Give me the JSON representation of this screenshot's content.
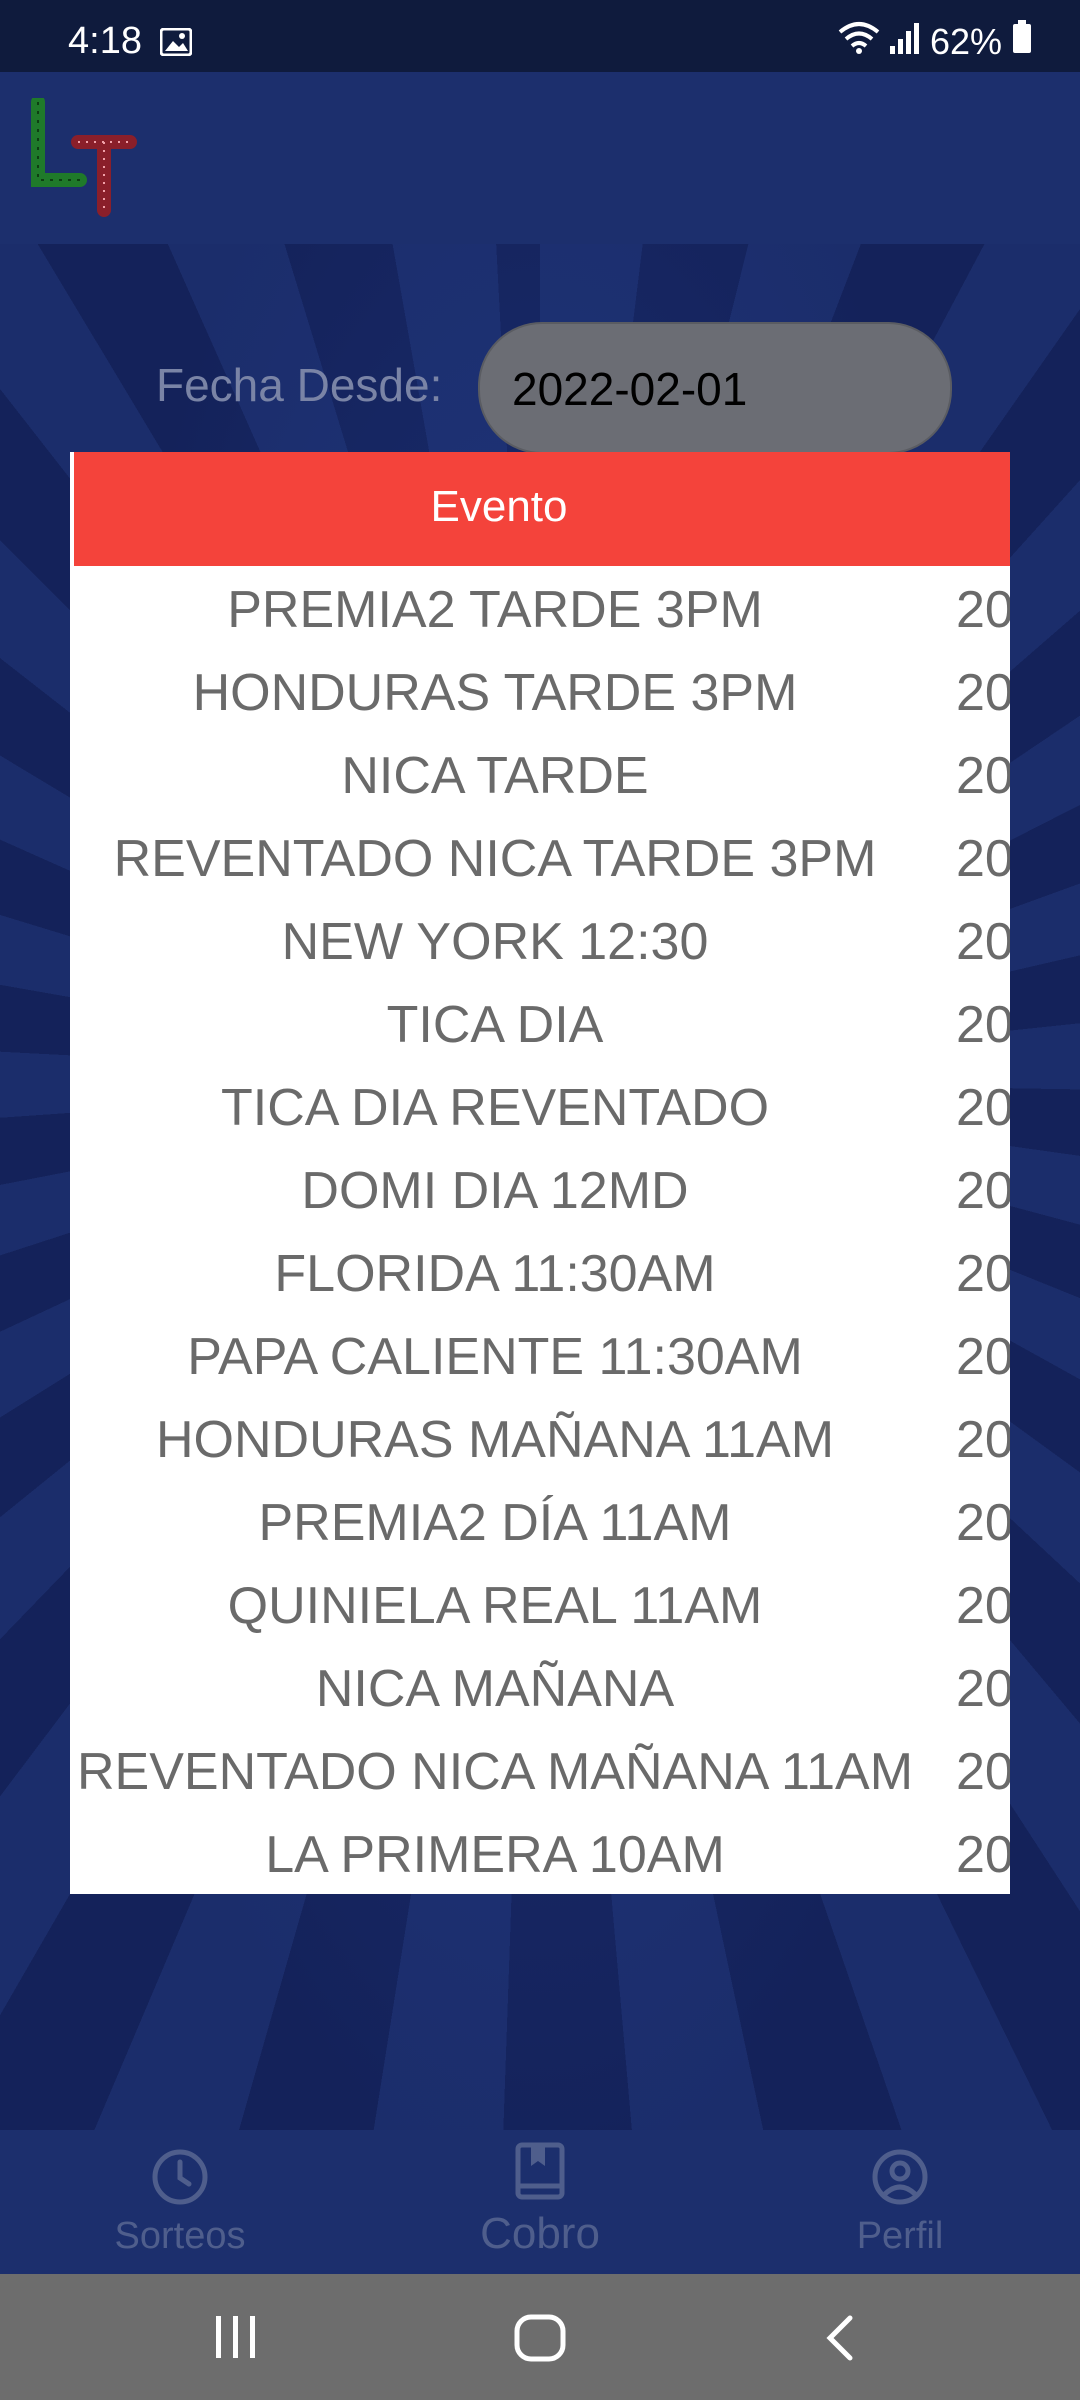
{
  "status_bar": {
    "time": "4:18",
    "battery": "62%"
  },
  "form": {
    "date_from_label": "Fecha Desde:",
    "date_from_value": "2022-02-01"
  },
  "dialog": {
    "header": "Evento",
    "rows": [
      {
        "event": "PREMIA2 TARDE 3PM",
        "date": "20"
      },
      {
        "event": "HONDURAS TARDE 3PM",
        "date": "20"
      },
      {
        "event": "NICA TARDE",
        "date": "20"
      },
      {
        "event": "REVENTADO NICA TARDE 3PM",
        "date": "20"
      },
      {
        "event": "NEW YORK 12:30",
        "date": "20"
      },
      {
        "event": "TICA DIA",
        "date": "20"
      },
      {
        "event": "TICA DIA REVENTADO",
        "date": "20"
      },
      {
        "event": "DOMI DIA 12MD",
        "date": "20"
      },
      {
        "event": "FLORIDA 11:30AM",
        "date": "20"
      },
      {
        "event": "PAPA CALIENTE 11:30AM",
        "date": "20"
      },
      {
        "event": "HONDURAS MAÑANA 11AM",
        "date": "20"
      },
      {
        "event": "PREMIA2 DÍA 11AM",
        "date": "20"
      },
      {
        "event": "QUINIELA REAL 11AM",
        "date": "20"
      },
      {
        "event": "NICA MAÑANA",
        "date": "20"
      },
      {
        "event": "REVENTADO NICA MAÑANA 11AM",
        "date": "20"
      },
      {
        "event": "LA PRIMERA 10AM",
        "date": "20"
      }
    ]
  },
  "bottom_nav": {
    "sorteos": {
      "label": "Sorteos",
      "icon": "clock-icon"
    },
    "cobro": {
      "label": "Cobro",
      "icon": "book-icon"
    },
    "perfil": {
      "label": "Perfil",
      "icon": "user-circle-icon"
    }
  },
  "colors": {
    "header_red": "#f4433b",
    "app_bar": "#1c2f6d",
    "nav_icon": "#4f5e8c"
  }
}
